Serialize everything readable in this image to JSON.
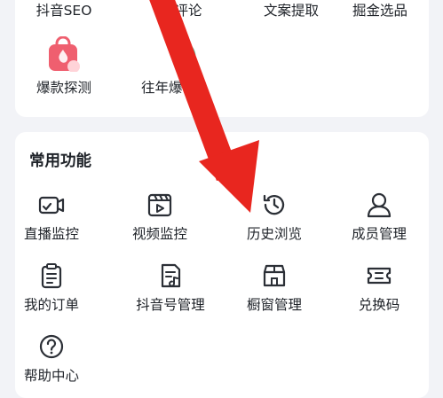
{
  "top_section": {
    "row1": [
      "抖音SEO",
      "评论",
      "文案提取",
      "掘金选品"
    ],
    "row2": [
      "爆款探测",
      "往年爆"
    ]
  },
  "common": {
    "title": "常用功能",
    "items": [
      "直播监控",
      "视频监控",
      "历史浏览",
      "成员管理",
      "我的订单",
      "抖音号管理",
      "橱窗管理",
      "兑换码",
      "帮助中心"
    ]
  },
  "colors": {
    "arrow": "#e8261f",
    "icon_stroke": "#2b2f36",
    "pink_icon": "#ef5f6f",
    "mint_icon": "#5fd6b4"
  }
}
